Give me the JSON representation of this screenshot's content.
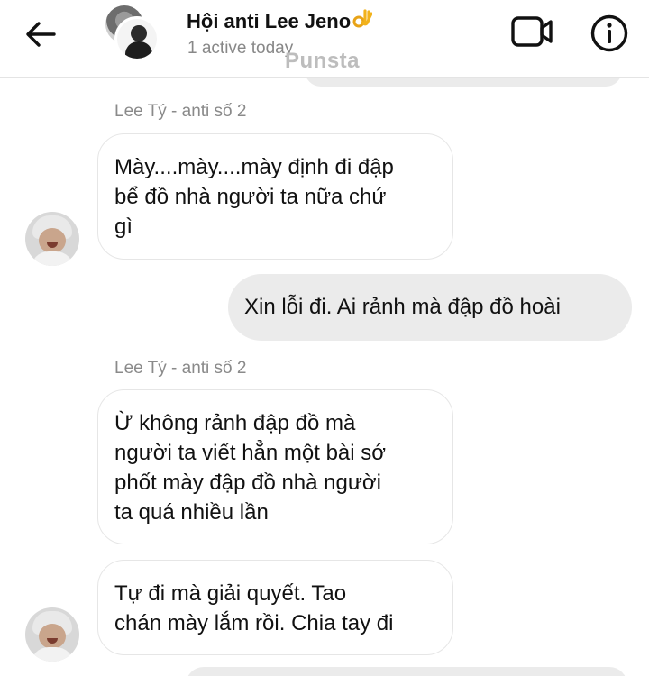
{
  "header": {
    "title": "Hội anti Lee Jeno",
    "status": "1 active today",
    "watermark": "Punsta"
  },
  "messages": [
    {
      "sender": "Lee Tý - anti số 2",
      "lines": [
        "Mày....mày....mày định đi đập",
        "bể đồ nhà người ta nữa chứ",
        "gì"
      ]
    },
    {
      "outgoing_text": "Xin lỗi đi. Ai rảnh mà đập đồ hoài"
    },
    {
      "sender": "Lee Tý - anti số 2",
      "lines": [
        "Ừ không rảnh đập đồ mà",
        "người ta viết hẳn một bài sớ",
        "phốt mày đập đồ nhà người",
        "ta quá nhiều lần"
      ]
    },
    {
      "lines": [
        "Tự đi mà giải quyết. Tao",
        "chán mày lắm rồi. Chia tay đi"
      ]
    }
  ],
  "icons": {
    "back": "arrow-left-icon",
    "video": "video-camera-icon",
    "info": "info-icon",
    "emoji": "ok-hand-emoji"
  }
}
